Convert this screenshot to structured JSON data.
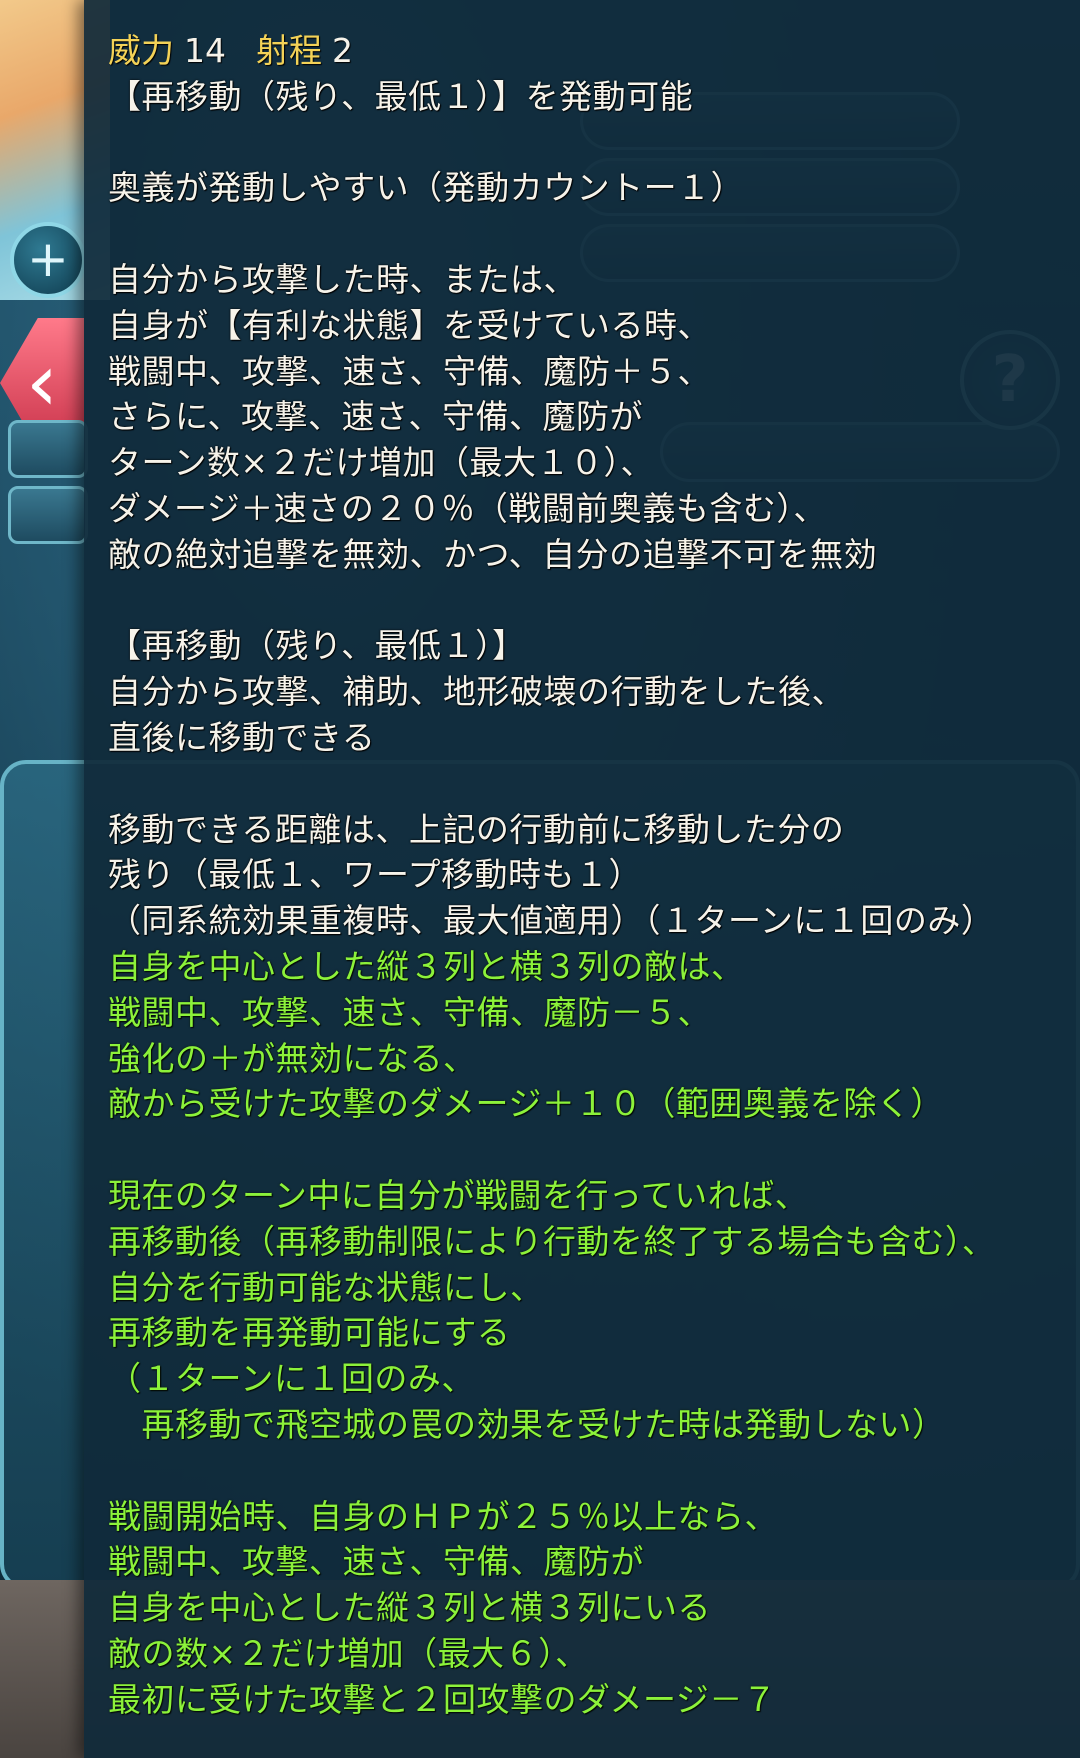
{
  "stats": {
    "might_label": "威力",
    "might_value": "14",
    "range_label": "射程",
    "range_value": "2"
  },
  "lines": [
    {
      "text": "【再移動（残り、最低１）】を発動可能",
      "color": "white"
    },
    {
      "text": "",
      "color": "white"
    },
    {
      "text": "奥義が発動しやすい（発動カウントー１）",
      "color": "white"
    },
    {
      "text": "",
      "color": "white"
    },
    {
      "text": "自分から攻撃した時、または、",
      "color": "white"
    },
    {
      "text": "自身が【有利な状態】を受けている時、",
      "color": "white"
    },
    {
      "text": "戦闘中、攻撃、速さ、守備、魔防＋５、",
      "color": "white"
    },
    {
      "text": "さらに、攻撃、速さ、守備、魔防が",
      "color": "white"
    },
    {
      "text": "ターン数×２だけ増加（最大１０）、",
      "color": "white"
    },
    {
      "text": "ダメージ＋速さの２０％（戦闘前奥義も含む）、",
      "color": "white"
    },
    {
      "text": "敵の絶対追撃を無効、かつ、自分の追撃不可を無効",
      "color": "white"
    },
    {
      "text": "",
      "color": "white"
    },
    {
      "text": "【再移動（残り、最低１）】",
      "color": "white"
    },
    {
      "text": "自分から攻撃、補助、地形破壊の行動をした後、",
      "color": "white"
    },
    {
      "text": "直後に移動できる",
      "color": "white"
    },
    {
      "text": "",
      "color": "white"
    },
    {
      "text": "移動できる距離は、上記の行動前に移動した分の",
      "color": "white"
    },
    {
      "text": "残り（最低１、ワープ移動時も１）",
      "color": "white"
    },
    {
      "text": "（同系統効果重複時、最大値適用）（１ターンに１回のみ）",
      "color": "white"
    },
    {
      "text": "自身を中心とした縦３列と横３列の敵は、",
      "color": "green"
    },
    {
      "text": "戦闘中、攻撃、速さ、守備、魔防－５、",
      "color": "green"
    },
    {
      "text": "強化の＋が無効になる、",
      "color": "green"
    },
    {
      "text": "敵から受けた攻撃のダメージ＋１０（範囲奥義を除く）",
      "color": "green"
    },
    {
      "text": "",
      "color": "green"
    },
    {
      "text": "現在のターン中に自分が戦闘を行っていれば、",
      "color": "green"
    },
    {
      "text": "再移動後（再移動制限により行動を終了する場合も含む）、",
      "color": "green"
    },
    {
      "text": "自分を行動可能な状態にし、",
      "color": "green"
    },
    {
      "text": "再移動を再発動可能にする",
      "color": "green"
    },
    {
      "text": "（１ターンに１回のみ、",
      "color": "green"
    },
    {
      "text": "　再移動で飛空城の罠の効果を受けた時は発動しない）",
      "color": "green"
    },
    {
      "text": "",
      "color": "green"
    },
    {
      "text": "戦闘開始時、自身のＨＰが２５％以上なら、",
      "color": "green"
    },
    {
      "text": "戦闘中、攻撃、速さ、守備、魔防が",
      "color": "green"
    },
    {
      "text": "自身を中心とした縦３列と横３列にいる",
      "color": "green"
    },
    {
      "text": "敵の数×２だけ増加（最大６）、",
      "color": "green"
    },
    {
      "text": "最初に受けた攻撃と２回攻撃のダメージ－７",
      "color": "green"
    }
  ],
  "colors": {
    "white_text": "#f6f3ea",
    "green_text": "#8cf23a",
    "stat_label": "#f3d257",
    "overlay_bg": "#102a3a"
  }
}
